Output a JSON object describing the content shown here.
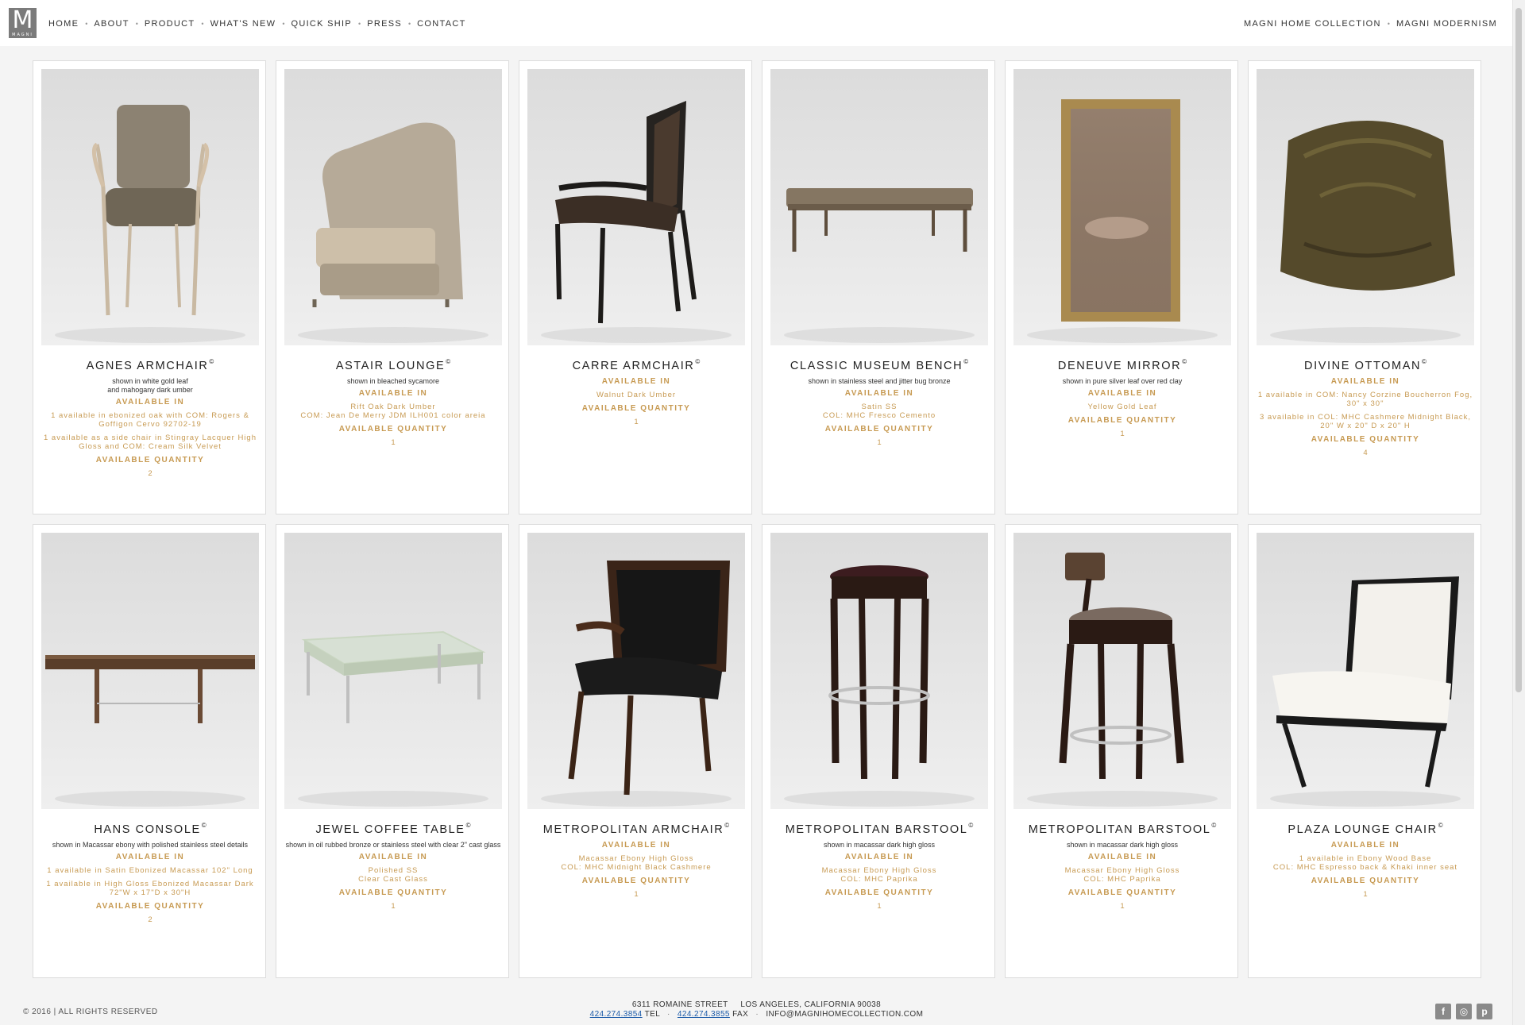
{
  "brand": {
    "logo_letter": "M",
    "logo_sub": "MAGNI"
  },
  "nav_left": [
    "HOME",
    "ABOUT",
    "PRODUCT",
    "WHAT'S NEW",
    "QUICK SHIP",
    "PRESS",
    "CONTACT"
  ],
  "nav_right": [
    "MAGNI HOME COLLECTION",
    "MAGNI MODERNISM"
  ],
  "nav_separator": "•",
  "colors": {
    "accent": "#c79a52",
    "text": "#222222",
    "card_border": "#dcdcdc"
  },
  "products": [
    {
      "name": "AGNES ARMCHAIR",
      "mark": "©",
      "shown": [
        "shown in white gold leaf",
        "and mahogany dark umber"
      ],
      "available_label": "AVAILABLE IN",
      "available": [
        "1 available in ebonized oak with COM: Rogers & Goffigon Cervo 92702-19",
        "1 available as a side chair in Stingray Lacquer High Gloss and COM: Cream Silk Velvet"
      ],
      "qty_label": "AVAILABLE QUANTITY",
      "qty": "2",
      "image": "armchair-velvet"
    },
    {
      "name": "ASTAIR LOUNGE",
      "mark": "©",
      "shown": [
        "shown in bleached sycamore"
      ],
      "available_label": "AVAILABLE IN",
      "available": [
        "Rift Oak Dark Umber\nCOM: Jean De Merry JDM ILH001 color areia"
      ],
      "qty_label": "AVAILABLE QUANTITY",
      "qty": "1",
      "image": "lounge-chair"
    },
    {
      "name": "CARRE ARMCHAIR",
      "mark": "©",
      "shown": [],
      "available_label": "AVAILABLE IN",
      "available": [
        "Walnut Dark Umber"
      ],
      "qty_label": "AVAILABLE QUANTITY",
      "qty": "1",
      "image": "dark-armchair"
    },
    {
      "name": "CLASSIC MUSEUM BENCH",
      "mark": "©",
      "shown": [
        "shown in stainless steel and jitter bug bronze"
      ],
      "available_label": "AVAILABLE IN",
      "available": [
        "Satin SS\nCOL: MHC Fresco Cemento"
      ],
      "qty_label": "AVAILABLE QUANTITY",
      "qty": "1",
      "image": "bench"
    },
    {
      "name": "DENEUVE MIRROR",
      "mark": "©",
      "shown": [
        "shown in pure silver leaf over red clay"
      ],
      "available_label": "AVAILABLE IN",
      "available": [
        "Yellow Gold Leaf"
      ],
      "qty_label": "AVAILABLE QUANTITY",
      "qty": "1",
      "image": "mirror"
    },
    {
      "name": "DIVINE OTTOMAN",
      "mark": "©",
      "shown": [],
      "available_label": "AVAILABLE IN",
      "available": [
        "1 available in COM: Nancy Corzine Boucherron Fog, 30\" x 30\"",
        "3 available in COL: MHC Cashmere Midnight Black, 20\" W x 20\" D x 20\" H"
      ],
      "qty_label": "AVAILABLE QUANTITY",
      "qty": "4",
      "image": "ottoman"
    },
    {
      "name": "HANS CONSOLE",
      "mark": "©",
      "shown": [
        "shown in Macassar ebony with polished stainless steel details"
      ],
      "available_label": "AVAILABLE IN",
      "available": [
        "1 available in Satin Ebonized Macassar 102\" Long",
        "1 available in High Gloss Ebonized Macassar Dark\n72\"W x 17\"D x 30\"H"
      ],
      "qty_label": "AVAILABLE QUANTITY",
      "qty": "2",
      "image": "console"
    },
    {
      "name": "JEWEL COFFEE TABLE",
      "mark": "©",
      "shown": [
        "shown in oil rubbed bronze or stainless steel with clear 2\" cast glass"
      ],
      "available_label": "AVAILABLE IN",
      "available": [
        "Polished SS\nClear Cast Glass"
      ],
      "qty_label": "AVAILABLE QUANTITY",
      "qty": "1",
      "image": "coffee-table"
    },
    {
      "name": "METROPOLITAN ARMCHAIR",
      "mark": "©",
      "shown": [],
      "available_label": "AVAILABLE IN",
      "available": [
        "Macassar Ebony High Gloss\nCOL: MHC Midnight Black Cashmere"
      ],
      "qty_label": "AVAILABLE QUANTITY",
      "qty": "1",
      "image": "leather-armchair"
    },
    {
      "name": "METROPOLITAN BARSTOOL",
      "mark": "©",
      "shown": [
        "shown in macassar dark high gloss"
      ],
      "available_label": "AVAILABLE IN",
      "available": [
        "Macassar Ebony High Gloss\nCOL: MHC Paprika"
      ],
      "qty_label": "AVAILABLE QUANTITY",
      "qty": "1",
      "image": "barstool"
    },
    {
      "name": "METROPOLITAN BARSTOOL",
      "mark": "©",
      "shown": [
        "shown in macassar dark high gloss"
      ],
      "available_label": "AVAILABLE IN",
      "available": [
        "Macassar Ebony High Gloss\nCOL: MHC Paprika"
      ],
      "qty_label": "AVAILABLE QUANTITY",
      "qty": "1",
      "image": "barstool-back"
    },
    {
      "name": "PLAZA LOUNGE CHAIR",
      "mark": "©",
      "shown": [],
      "available_label": "AVAILABLE IN",
      "available": [
        "1 available in Ebony Wood Base\nCOL: MHC Espresso back & Khaki inner seat"
      ],
      "qty_label": "AVAILABLE QUANTITY",
      "qty": "1",
      "image": "white-lounge"
    }
  ],
  "footer": {
    "copyright": "© 2016 | ALL RIGHTS RESERVED",
    "address": "6311 ROMAINE STREET     LOS ANGELES, CALIFORNIA 90038",
    "tel": "424.274.3854",
    "tel_label": "TEL",
    "fax": "424.274.3855",
    "fax_label": "FAX",
    "email": "INFO@MAGNIHOMECOLLECTION.COM",
    "social": [
      "facebook-icon",
      "instagram-icon",
      "pinterest-icon"
    ]
  }
}
